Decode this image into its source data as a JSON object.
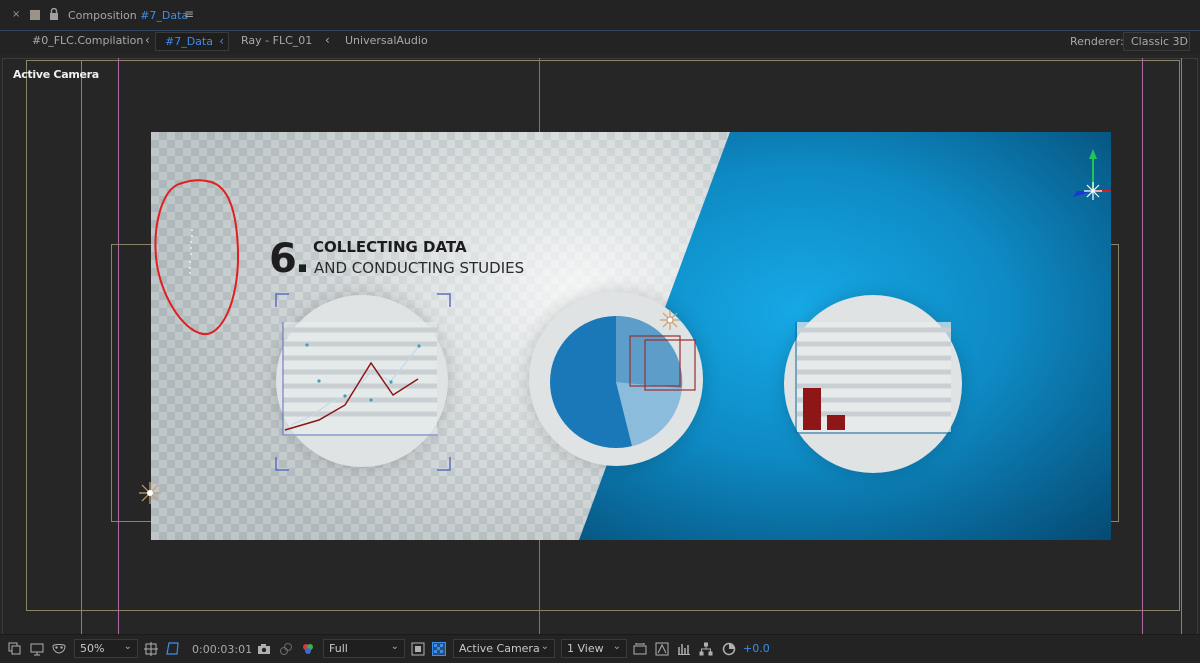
{
  "panel": {
    "close_glyph": "×",
    "title_prefix": "Composition",
    "comp_name": "#7_Data",
    "menu_glyph": "≡"
  },
  "breadcrumbs": {
    "items": [
      "#0_FLC.Compilation",
      "#7_Data",
      "Ray - FLC_01",
      "UniversalAudio"
    ],
    "arrow_glyph": "‹"
  },
  "renderer": {
    "label": "Renderer:",
    "value": "Classic 3D"
  },
  "viewer": {
    "camera_label": "Active Camera",
    "composition": {
      "number": "6.",
      "heading_line1": "COLLECTING DATA",
      "heading_line2": "AND CONDUCTING STUDIES"
    }
  },
  "toolbar": {
    "zoom": "50%",
    "timecode": "0:00:03:01",
    "resolution": "Full",
    "camera": "Active Camera",
    "views": "1 View",
    "exposure": "+0.0",
    "caret_glyph": "⌄"
  },
  "icons": [
    "close-icon",
    "composition-icon",
    "lock-icon",
    "panel-menu-icon",
    "always-preview-icon",
    "monitor-icon",
    "mask-icon",
    "grid-guides-icon",
    "region-of-interest-icon",
    "snapshot-icon",
    "show-snapshot-icon",
    "color-channels-icon",
    "transparency-grid-icon",
    "pixel-aspect-icon",
    "draft-3d-icon",
    "motion-blur-icon",
    "flowchart-icon",
    "reset-exposure-icon"
  ],
  "colors": {
    "accent": "#3d8ee8",
    "panel_bg": "#232323",
    "viewer_bg": "#262626",
    "sketch_red": "#e01f1f",
    "chart_red": "#8f1616",
    "bg_blue": "#0e8ac4"
  }
}
